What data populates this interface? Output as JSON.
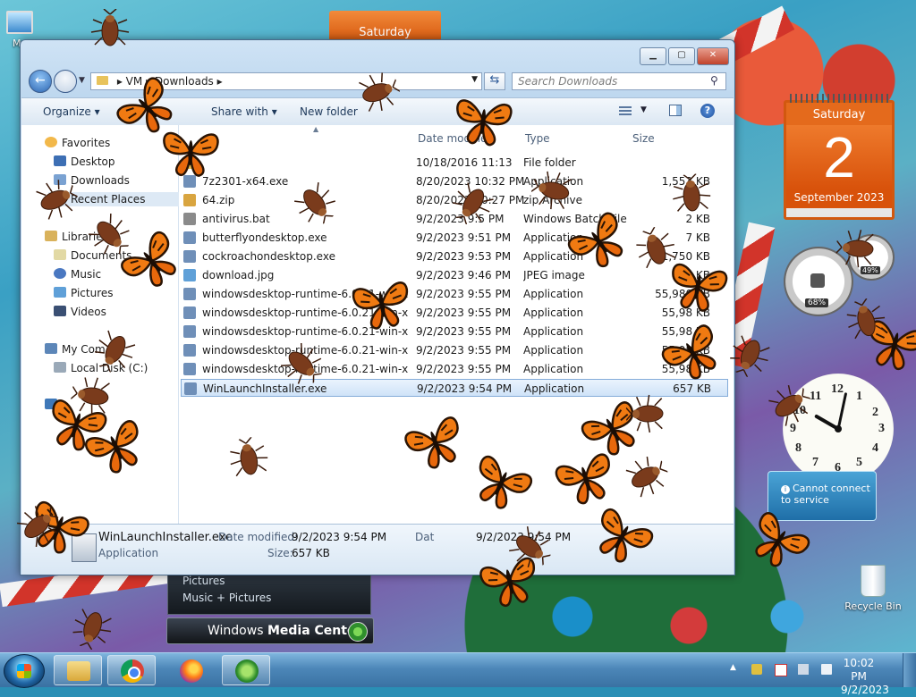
{
  "desktop": {
    "icons": [
      {
        "label": "My",
        "id": "my-computer"
      },
      {
        "label": "Recycle Bin",
        "id": "recycle-bin"
      }
    ],
    "calendar_small": {
      "day": "Saturday"
    },
    "calendar_big": {
      "day": "Saturday",
      "date": "2",
      "month_year": "September 2023"
    },
    "meter": {
      "cpu": "68%",
      "memory": "49%"
    },
    "clock_numbers": [
      "12",
      "1",
      "2",
      "3",
      "4",
      "5",
      "6",
      "7",
      "8",
      "9",
      "10",
      "11"
    ],
    "weather_gadget": {
      "message": "Cannot connect to service"
    },
    "media_center": {
      "items": [
        "Pictures",
        "Music + Pictures"
      ],
      "title": "Windows",
      "title_bold": "Media Center"
    }
  },
  "explorer": {
    "address": {
      "segments": [
        "VM",
        "Downloads"
      ]
    },
    "search_placeholder": "Search Downloads",
    "toolbar": {
      "organize": "Organize",
      "share_with": "Share with",
      "new_folder": "New folder"
    },
    "nav": {
      "favorites": "Favorites",
      "favorites_items": [
        "Desktop",
        "Downloads",
        "Recent Places"
      ],
      "libraries": "Libraries",
      "libraries_items": [
        "Documents",
        "Music",
        "Pictures",
        "Videos"
      ],
      "computer": "My Com",
      "computer_items": [
        "Local Disk (C:)"
      ]
    },
    "columns": {
      "name": "",
      "date": "Date modified",
      "type": "Type",
      "size": "Size"
    },
    "files": [
      {
        "name": "",
        "date": "10/18/2016 11:13",
        "type": "File folder",
        "size": "",
        "icon": "folder"
      },
      {
        "name": "7z2301-x64.exe",
        "date": "8/20/2023 10:32 PM",
        "type": "Application",
        "size": "1,553 KB",
        "icon": "exe"
      },
      {
        "name": "64.zip",
        "date": "8/20/2023 10:27 PM",
        "type": "zip Archive",
        "size": "",
        "icon": "zip"
      },
      {
        "name": "antivirus.bat",
        "date": "9/2/2023 9:5 PM",
        "type": "Windows Batch File",
        "size": "2 KB",
        "icon": "bat"
      },
      {
        "name": "butterflyondesktop.exe",
        "date": "9/2/2023 9:51 PM",
        "type": "Application",
        "size": "7 KB",
        "icon": "exe"
      },
      {
        "name": "cockroachondesktop.exe",
        "date": "9/2/2023 9:53 PM",
        "type": "Application",
        "size": "1,750 KB",
        "icon": "exe"
      },
      {
        "name": "download.jpg",
        "date": "9/2/2023 9:46 PM",
        "type": "JPEG image",
        "size": "10 KB",
        "icon": "jpg"
      },
      {
        "name": "windowsdesktop-runtime-6.0.21-win-x64...",
        "date": "9/2/2023 9:55 PM",
        "type": "Application",
        "size": "55,980 KB",
        "icon": "exe"
      },
      {
        "name": "windowsdesktop-runtime-6.0.21-win-x64...",
        "date": "9/2/2023 9:55 PM",
        "type": "Application",
        "size": "55,98 KB",
        "icon": "exe"
      },
      {
        "name": "windowsdesktop-runtime-6.0.21-win-x64...",
        "date": "9/2/2023 9:55 PM",
        "type": "Application",
        "size": "55,98 KB",
        "icon": "exe"
      },
      {
        "name": "windowsdesktop-runtime-6.0.21-win-x64...",
        "date": "9/2/2023 9:55 PM",
        "type": "Application",
        "size": "55,98 KB",
        "icon": "exe"
      },
      {
        "name": "windowsdesktop-runtime-6.0.21-win-x64...",
        "date": "9/2/2023 9:55 PM",
        "type": "Application",
        "size": "55,98 KB",
        "icon": "exe"
      },
      {
        "name": "WinLaunchInstaller.exe",
        "date": "9/2/2023 9:54 PM",
        "type": "Application",
        "size": "657 KB",
        "icon": "exe",
        "selected": true
      }
    ],
    "details": {
      "name": "WinLaunchInstaller.exe",
      "kind": "Application",
      "modified_label": "Date modified:",
      "modified_value": "9/2/2023 9:54 PM",
      "size_label": "Size:",
      "size_value": "657 KB",
      "created_label": "Dat",
      "created_value": "9/2/2023 9:54 PM"
    }
  },
  "taskbar": {
    "apps": [
      "Windows Explorer",
      "Google Chrome",
      "Firefox",
      "Windows Media Center"
    ],
    "time": "10:02 PM",
    "date": "9/2/2023"
  },
  "colors": {
    "orange": "#e46a1c",
    "butterfly": "#f07a12",
    "roach": "#7a3b1c",
    "selection": "#cfe3f8"
  }
}
